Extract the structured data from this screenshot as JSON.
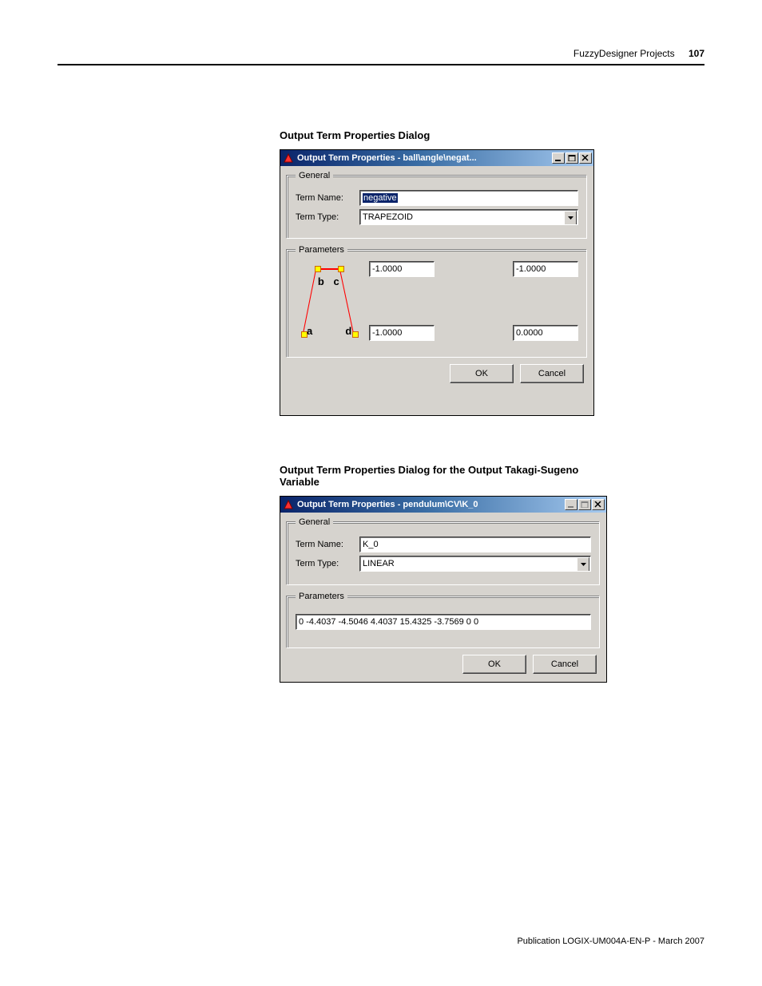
{
  "header": {
    "section_title": "FuzzyDesigner Projects",
    "page_number": "107"
  },
  "footer": {
    "publication": "Publication LOGIX-UM004A-EN-P - March 2007"
  },
  "dialog1": {
    "caption": "Output Term Properties Dialog",
    "title": "Output Term Properties - ball\\angle\\negat...",
    "general_legend": "General",
    "term_name_label": "Term Name:",
    "term_name_value": "negative",
    "term_type_label": "Term Type:",
    "term_type_value": "TRAPEZOID",
    "parameters_legend": "Parameters",
    "param_b": "-1.0000",
    "param_c": "-1.0000",
    "param_a": "-1.0000",
    "param_d": "0.0000",
    "labels": {
      "a": "a",
      "b": "b",
      "c": "c",
      "d": "d"
    },
    "ok_label": "OK",
    "cancel_label": "Cancel"
  },
  "dialog2": {
    "caption": "Output Term Properties Dialog for the Output Takagi-Sugeno Variable",
    "title": "Output Term Properties - pendulum\\CV\\K_0",
    "general_legend": "General",
    "term_name_label": "Term Name:",
    "term_name_value": "K_0",
    "term_type_label": "Term Type:",
    "term_type_value": "LINEAR",
    "parameters_legend": "Parameters",
    "param_values": "0 -4.4037 -4.5046 4.4037 15.4325 -3.7569 0 0",
    "ok_label": "OK",
    "cancel_label": "Cancel"
  },
  "chart_data": {
    "type": "line",
    "title": "",
    "description": "Trapezoid membership function preview with labeled corner points a, b, c, d",
    "points": [
      {
        "name": "a",
        "value": -1.0
      },
      {
        "name": "b",
        "value": -1.0
      },
      {
        "name": "c",
        "value": -1.0
      },
      {
        "name": "d",
        "value": 0.0
      }
    ]
  }
}
